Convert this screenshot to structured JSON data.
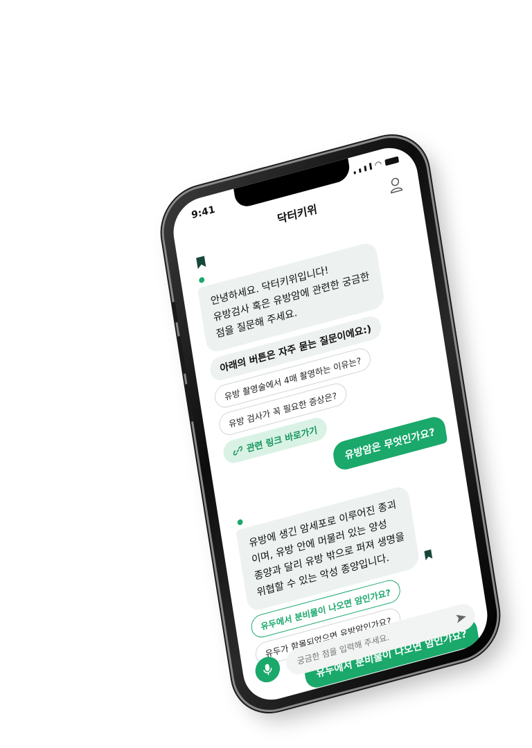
{
  "status": {
    "time": "9:41"
  },
  "header": {
    "title": "닥터키위"
  },
  "icons": {
    "bookmark": "bookmark-icon",
    "profile": "profile-icon",
    "link": "link-icon",
    "mic": "mic-icon",
    "send": "send-icon"
  },
  "colors": {
    "accent": "#1aa86b",
    "bot_bubble": "#edf2f0",
    "link_chip": "#d9f2e5"
  },
  "chat": {
    "greeting_lines": [
      "안녕하세요. 닥터키위입니다!",
      "유방검사 혹은 유방암에 관련한 궁금한",
      "점을 질문해 주세요."
    ],
    "faq_title": "아래의 버튼은 자주 묻는 질문이에요:)",
    "faq_chips": [
      "유방 촬영술에서 4매 촬영하는 이유는?",
      "유방 검사가 꼭 필요한 증상은?"
    ],
    "link_chip": "관련 링크 바로가기",
    "user_message_1": "유방암은 무엇인가요?",
    "answer_lines": [
      "유방에 생긴 암세포로 이루어진 종괴",
      "이며, 유방 안에 머물러 있는 양성",
      "종양과 달리 유방 밖으로 퍼져 생명을",
      "위협할 수 있는 악성 종양입니다."
    ],
    "followup_chips": [
      "유두에서 분비물이 나오면 암인가요?",
      "유두가 함몰되었으면 유방암인가요?"
    ],
    "user_message_2": "유두에서 분비물이 나오면 암인가요?"
  },
  "input": {
    "placeholder": "궁금한 점을 입력해 주세요."
  }
}
